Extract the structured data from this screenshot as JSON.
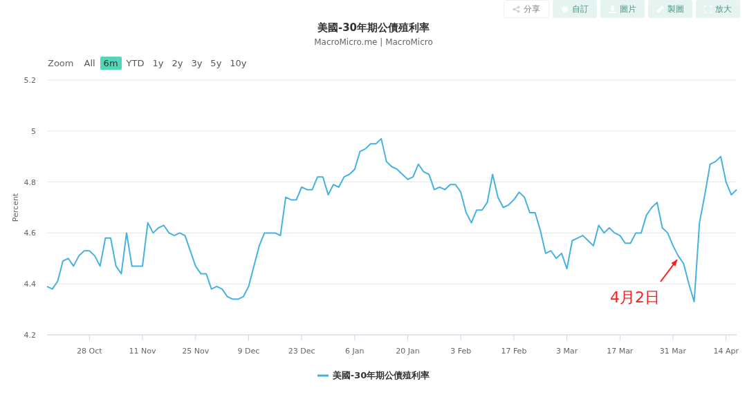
{
  "toolbar": [
    {
      "label": "分享",
      "kind": "share"
    },
    {
      "label": "自訂",
      "kind": "gear"
    },
    {
      "label": "圖片",
      "kind": "download"
    },
    {
      "label": "製圖",
      "kind": "pencil"
    },
    {
      "label": "放大",
      "kind": "expand"
    }
  ],
  "title": "美國-30年期公債殖利率",
  "subtitle": "MacroMicro.me | MacroMicro",
  "zoom": {
    "label": "Zoom",
    "options": [
      {
        "label": "All",
        "selected": false
      },
      {
        "label": "6m",
        "selected": true
      },
      {
        "label": "YTD",
        "selected": false
      },
      {
        "label": "1y",
        "selected": false
      },
      {
        "label": "2y",
        "selected": false
      },
      {
        "label": "3y",
        "selected": false
      },
      {
        "label": "5y",
        "selected": false
      },
      {
        "label": "10y",
        "selected": false
      }
    ]
  },
  "chart_data": {
    "type": "line",
    "ylabel": "Percent",
    "grid": true,
    "ylim": [
      4.2,
      5.2
    ],
    "categories": [
      null,
      null,
      null,
      null,
      null,
      null,
      null,
      null,
      "28 Oct",
      null,
      null,
      null,
      null,
      null,
      null,
      null,
      null,
      null,
      "11 Nov",
      null,
      null,
      null,
      null,
      null,
      null,
      null,
      null,
      null,
      "25 Nov",
      null,
      null,
      null,
      null,
      null,
      null,
      null,
      null,
      null,
      "9 Dec",
      null,
      null,
      null,
      null,
      null,
      null,
      null,
      null,
      null,
      "23 Dec",
      null,
      null,
      null,
      null,
      null,
      null,
      null,
      null,
      null,
      "6 Jan",
      null,
      null,
      null,
      null,
      null,
      null,
      null,
      null,
      null,
      "20 Jan",
      null,
      null,
      null,
      null,
      null,
      null,
      null,
      null,
      null,
      "3 Feb",
      null,
      null,
      null,
      null,
      null,
      null,
      null,
      null,
      null,
      "17 Feb",
      null,
      null,
      null,
      null,
      null,
      null,
      null,
      null,
      null,
      "3 Mar",
      null,
      null,
      null,
      null,
      null,
      null,
      null,
      null,
      null,
      "17 Mar",
      null,
      null,
      null,
      null,
      null,
      null,
      null,
      null,
      null,
      "31 Mar",
      null,
      null,
      null,
      null,
      null,
      null,
      null,
      null,
      null,
      "14 Apr",
      null,
      null
    ],
    "yticks": [
      {
        "value": 4.2,
        "label": "4.2"
      },
      {
        "value": 4.4,
        "label": "4.4"
      },
      {
        "value": 4.6,
        "label": "4.6"
      },
      {
        "value": 4.8,
        "label": "4.8"
      },
      {
        "value": 5,
        "label": "5"
      },
      {
        "value": 5.2,
        "label": "5.2"
      }
    ],
    "series": [
      {
        "name": "美國-30年期公債殖利率",
        "color": "#45b1e0",
        "values": [
          4.39,
          4.38,
          4.41,
          4.49,
          4.5,
          4.47,
          4.51,
          4.53,
          4.53,
          4.51,
          4.47,
          4.58,
          4.58,
          4.47,
          4.44,
          4.6,
          4.47,
          4.47,
          4.47,
          4.64,
          4.6,
          4.62,
          4.63,
          4.6,
          4.59,
          4.6,
          4.59,
          4.53,
          4.47,
          4.44,
          4.44,
          4.38,
          4.39,
          4.38,
          4.35,
          4.34,
          4.34,
          4.35,
          4.39,
          4.47,
          4.55,
          4.6,
          4.6,
          4.6,
          4.59,
          4.74,
          4.73,
          4.73,
          4.78,
          4.77,
          4.77,
          4.82,
          4.82,
          4.75,
          4.79,
          4.78,
          4.82,
          4.83,
          4.85,
          4.92,
          4.93,
          4.95,
          4.95,
          4.97,
          4.88,
          4.86,
          4.85,
          4.83,
          4.81,
          4.82,
          4.87,
          4.84,
          4.83,
          4.77,
          4.78,
          4.77,
          4.79,
          4.79,
          4.76,
          4.68,
          4.64,
          4.69,
          4.69,
          4.72,
          4.83,
          4.74,
          4.7,
          4.71,
          4.73,
          4.76,
          4.74,
          4.68,
          4.68,
          4.61,
          4.52,
          4.53,
          4.5,
          4.52,
          4.46,
          4.57,
          4.58,
          4.59,
          4.57,
          4.55,
          4.63,
          4.6,
          4.62,
          4.6,
          4.59,
          4.56,
          4.56,
          4.6,
          4.6,
          4.67,
          4.7,
          4.72,
          4.62,
          4.6,
          4.55,
          4.51,
          4.48,
          4.4,
          4.33,
          4.64,
          4.75,
          4.87,
          4.88,
          4.9,
          4.8,
          4.75,
          4.77
        ]
      }
    ],
    "annotations": [
      "4月2日"
    ]
  }
}
